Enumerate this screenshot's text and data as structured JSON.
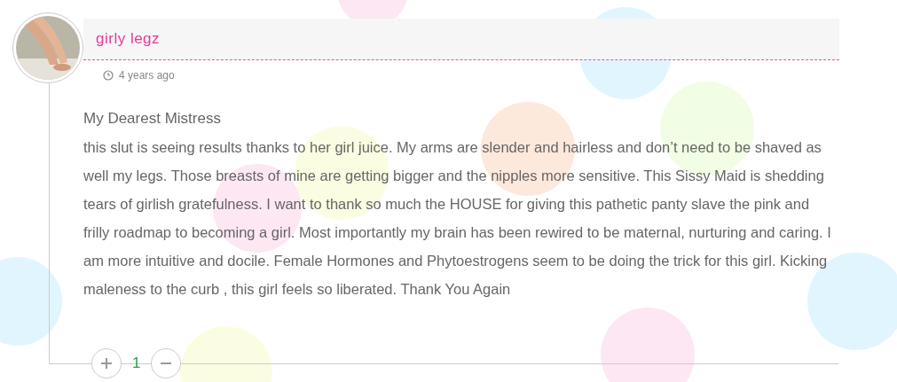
{
  "comment": {
    "author": "girly legz",
    "time": "4 years ago",
    "greeting": "My Dearest Mistress",
    "body": "this slut is seeing results thanks to her girl juice. My arms are slender and hairless and don’t need to be shaved as well my legs. Those breasts of mine are getting bigger and the nipples more sensitive. This Sissy Maid is shedding tears of girlish gratefulness. I want to thank so much the HOUSE for giving this pathetic panty slave the pink and frilly roadmap to becoming a girl. Most importantly my brain has been rewired to be maternal, nurturing and caring. I am more intuitive and docile. Female Hormones and Phytoestrogens seem to be doing the trick for this girl. Kicking maleness to the curb , this girl feels so liberated. Thank You Again",
    "score": "1"
  }
}
